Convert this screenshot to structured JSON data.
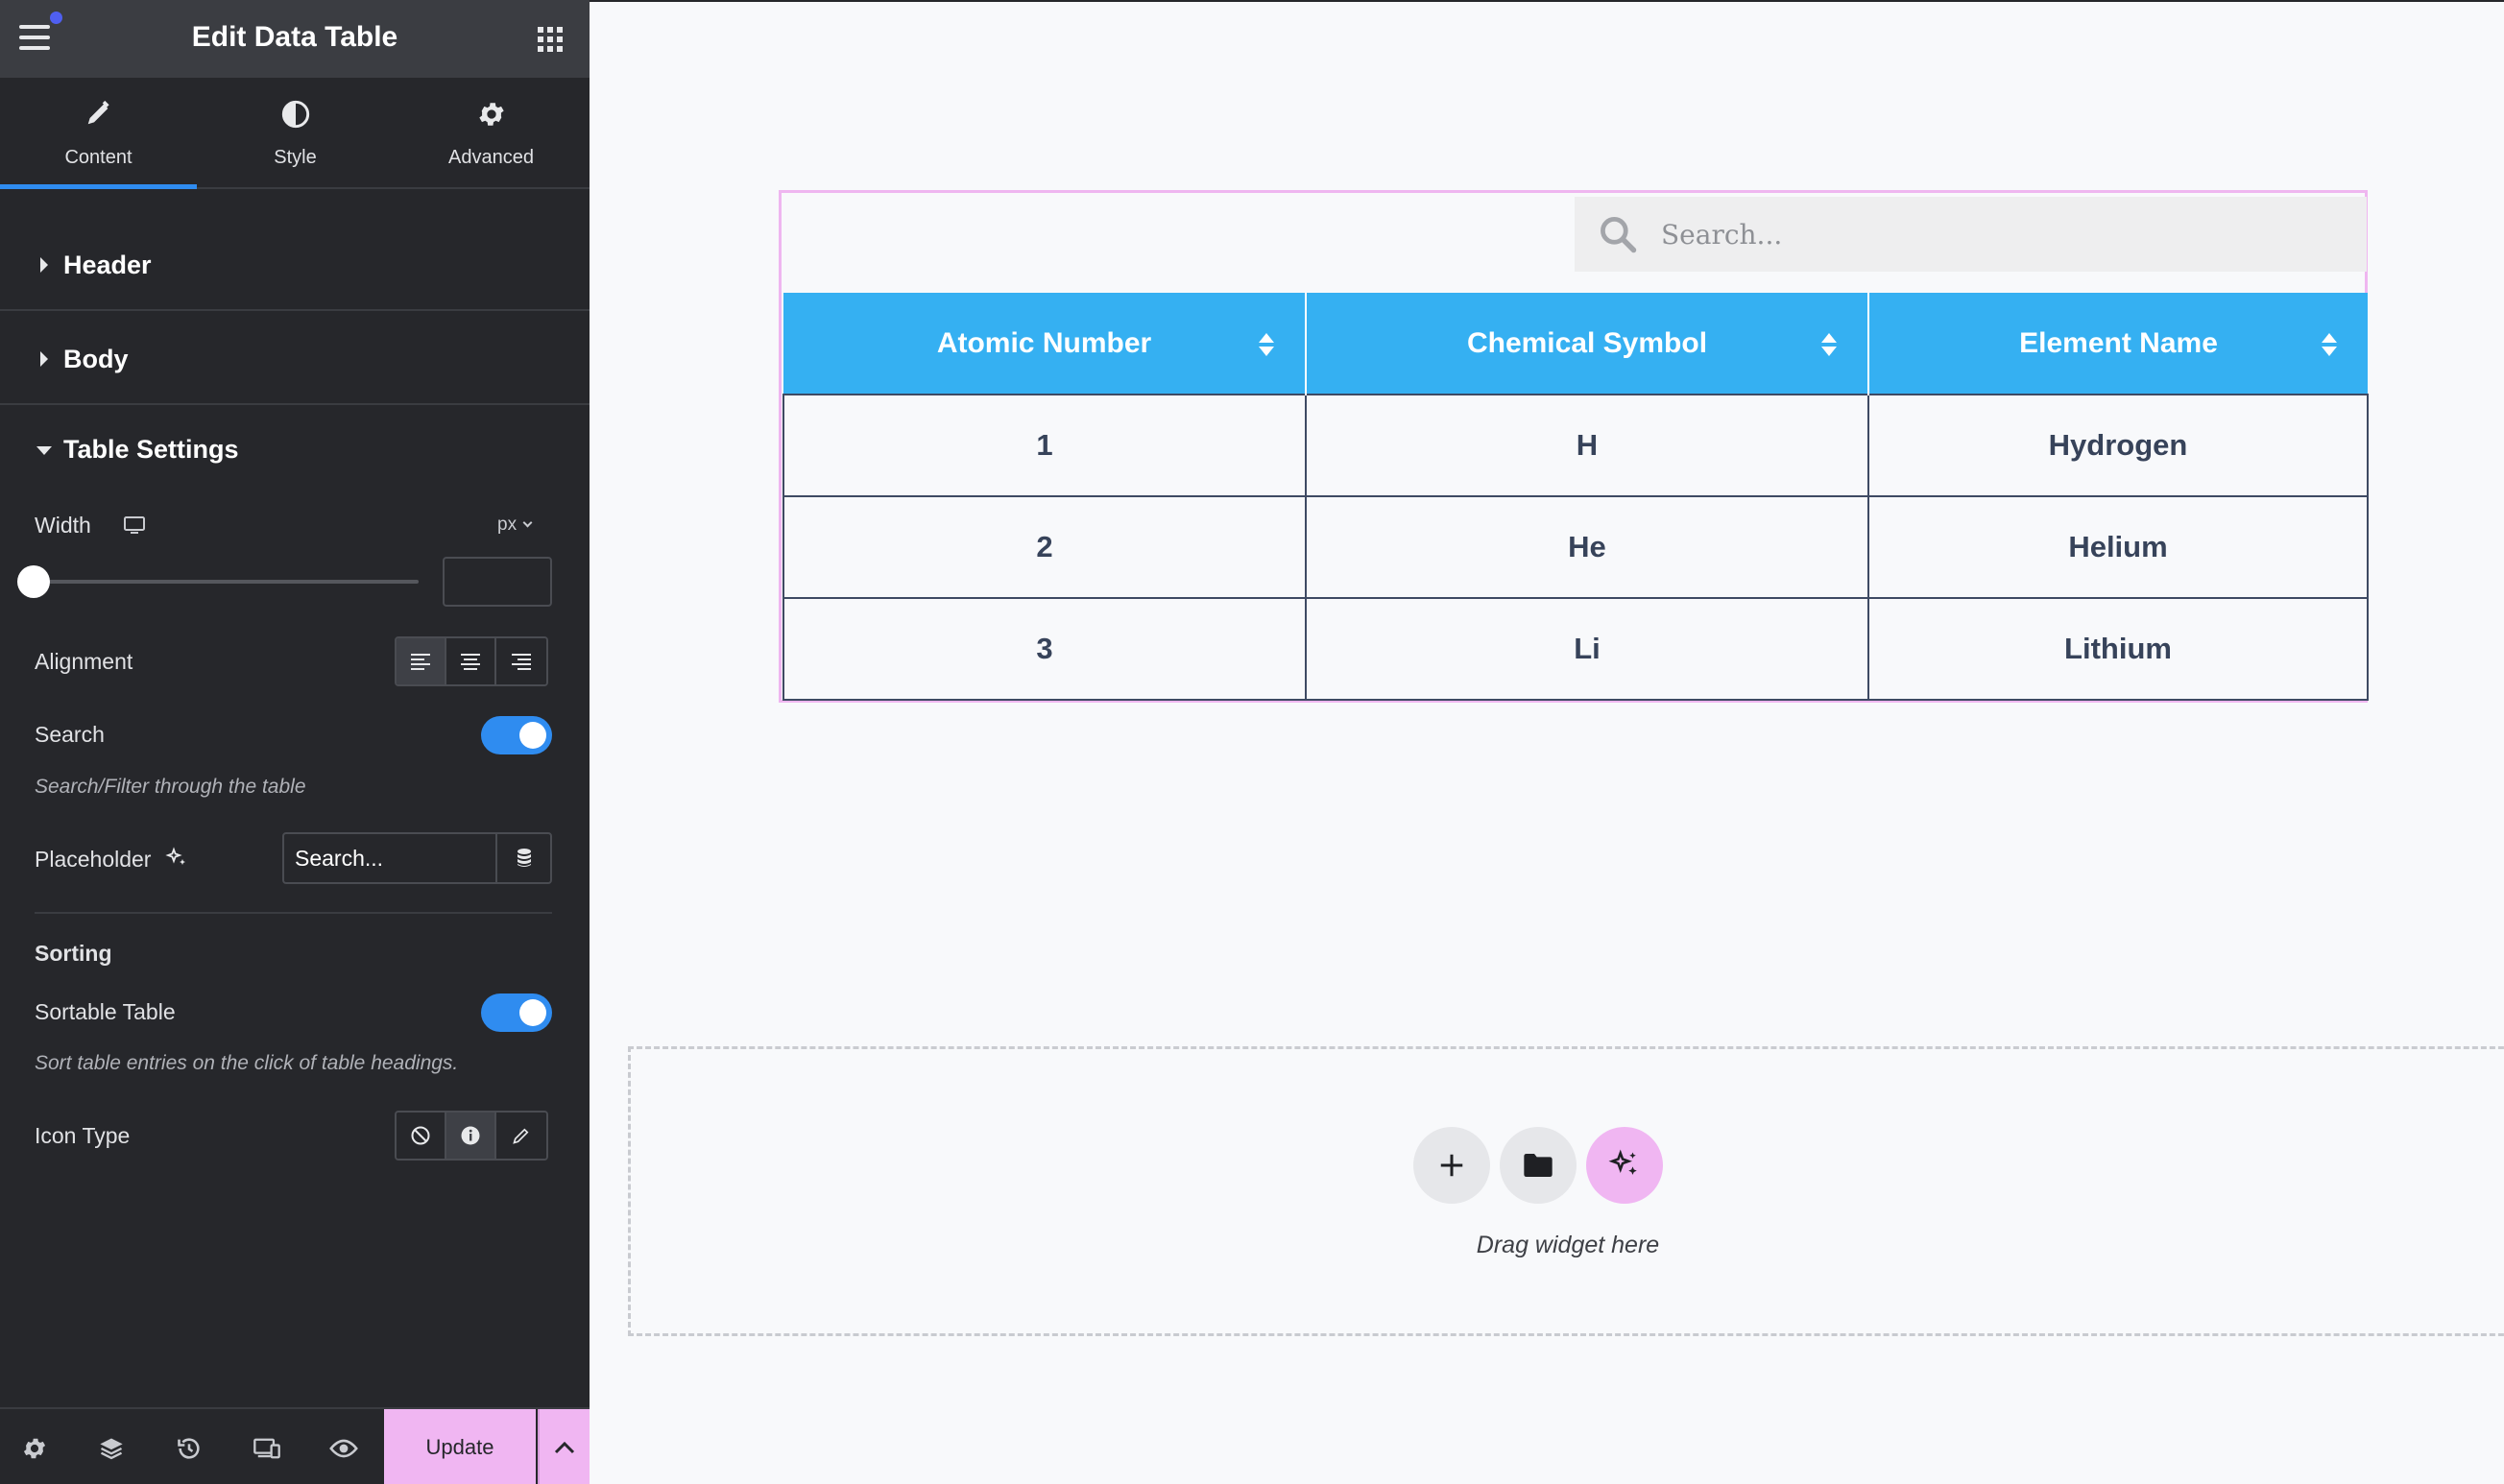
{
  "panel": {
    "title": "Edit Data Table",
    "tabs": [
      {
        "label": "Content",
        "icon": "pencil-icon",
        "active": true
      },
      {
        "label": "Style",
        "icon": "contrast-icon",
        "active": false
      },
      {
        "label": "Advanced",
        "icon": "gear-icon",
        "active": false
      }
    ],
    "sections": {
      "header": "Header",
      "body": "Body",
      "table_settings": "Table Settings"
    },
    "width": {
      "label": "Width",
      "unit": "px",
      "value": ""
    },
    "alignment": {
      "label": "Alignment",
      "options": [
        "align-left-icon",
        "align-center-icon",
        "align-right-icon"
      ],
      "selected": "align-left-icon"
    },
    "search": {
      "label": "Search",
      "enabled": true,
      "hint": "Search/Filter through the table"
    },
    "placeholder": {
      "label": "Placeholder",
      "value": "Search..."
    },
    "sorting": {
      "heading": "Sorting",
      "sortable_label": "Sortable Table",
      "enabled": true,
      "hint": "Sort table entries on the click of table headings."
    },
    "icon_type": {
      "label": "Icon Type",
      "options": [
        "none-icon",
        "info-icon",
        "pencil-icon"
      ],
      "selected": "info-icon"
    },
    "footer": {
      "update_label": "Update"
    }
  },
  "canvas": {
    "search_placeholder": "Search...",
    "table": {
      "columns": [
        "Atomic Number",
        "Chemical Symbol",
        "Element Name"
      ],
      "rows": [
        [
          "1",
          "H",
          "Hydrogen"
        ],
        [
          "2",
          "He",
          "Helium"
        ],
        [
          "3",
          "Li",
          "Lithium"
        ]
      ]
    },
    "dropzone_text": "Drag widget here"
  },
  "colors": {
    "panel_bg": "#26272b",
    "accent_blue": "#2f8cf0",
    "table_header": "#35b0f2",
    "update_pink": "#f0b6f2"
  }
}
